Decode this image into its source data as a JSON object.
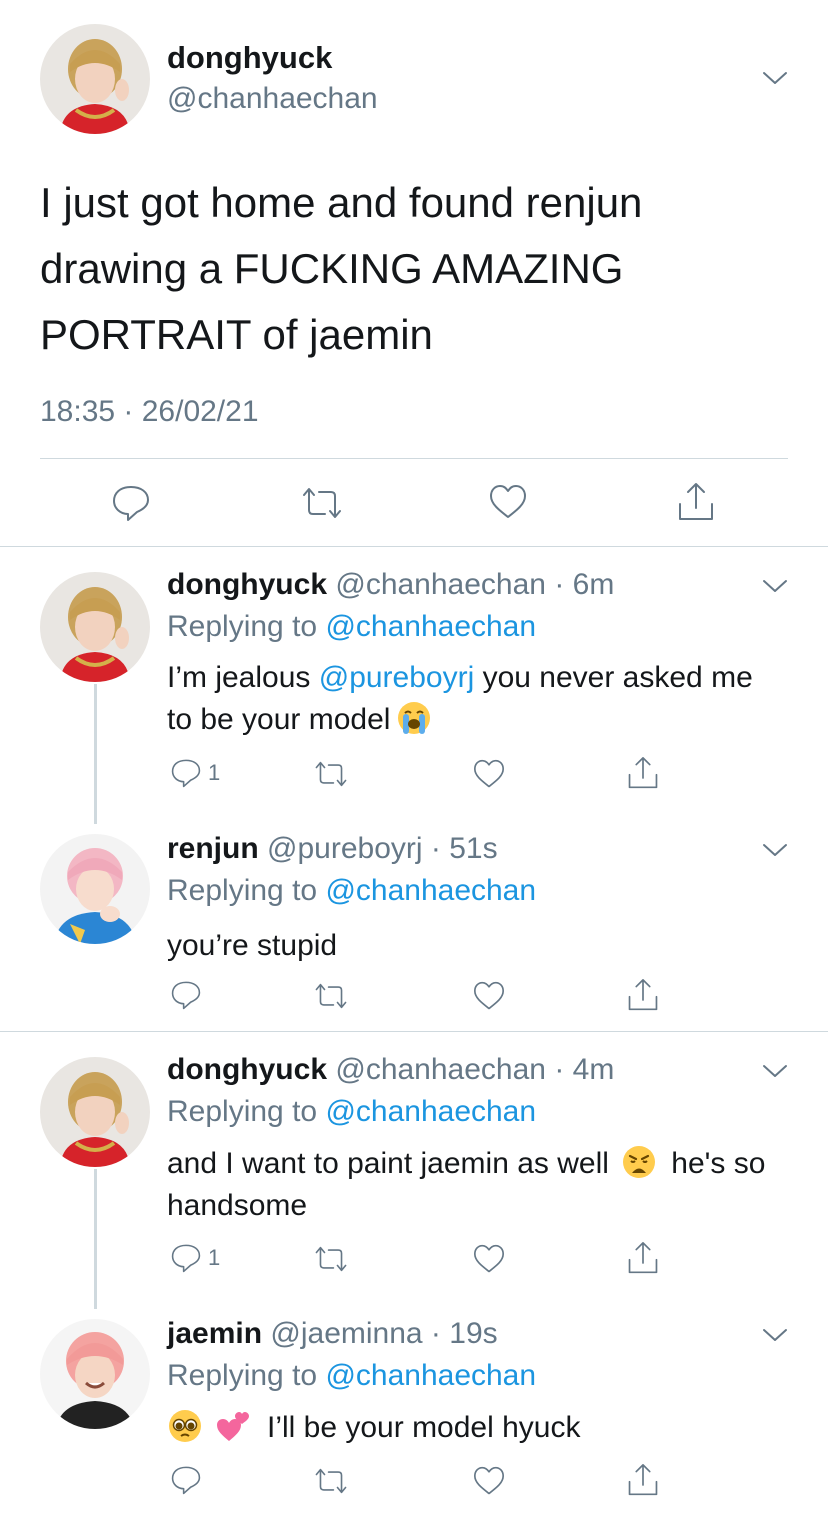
{
  "main_tweet": {
    "name": "donghyuck",
    "handle": "@chanhaechan",
    "text": "I just got home and found renjun drawing a FUCKING AMAZING PORTRAIT of jaemin",
    "timestamp": "18:35 · 26/02/21"
  },
  "replies": [
    {
      "name": "donghyuck",
      "handle": "@chanhaechan",
      "time": "6m",
      "replying_label": "Replying to",
      "replying_to": "@chanhaechan",
      "text_before": "I’m jealous ",
      "mention": "@pureboyrj",
      "text_after": " you never asked me to be your model",
      "emoji": "loudly-crying-face",
      "reply_count": "1"
    },
    {
      "name": "renjun",
      "handle": "@pureboyrj",
      "time": "51s",
      "replying_label": "Replying to",
      "replying_to": "@chanhaechan",
      "text": "you’re stupid",
      "reply_count": ""
    },
    {
      "name": "donghyuck",
      "handle": "@chanhaechan",
      "time": "4m",
      "replying_label": "Replying to",
      "replying_to": "@chanhaechan",
      "text_before": "and I want to paint jaemin as well",
      "emoji": "weary-face",
      "text_after": " he's so handsome",
      "reply_count": "1"
    },
    {
      "name": "jaemin",
      "handle": "@jaeminna",
      "time": "19s",
      "replying_label": "Replying to",
      "replying_to": "@chanhaechan",
      "emojis": [
        "pleading-face",
        "two-hearts"
      ],
      "text": "I’ll be your model hyuck",
      "reply_count": ""
    }
  ],
  "separator": " · ",
  "colors": {
    "text": "#14171a",
    "secondary": "#657786",
    "link": "#1b95e0",
    "divider": "#cfd9de"
  }
}
